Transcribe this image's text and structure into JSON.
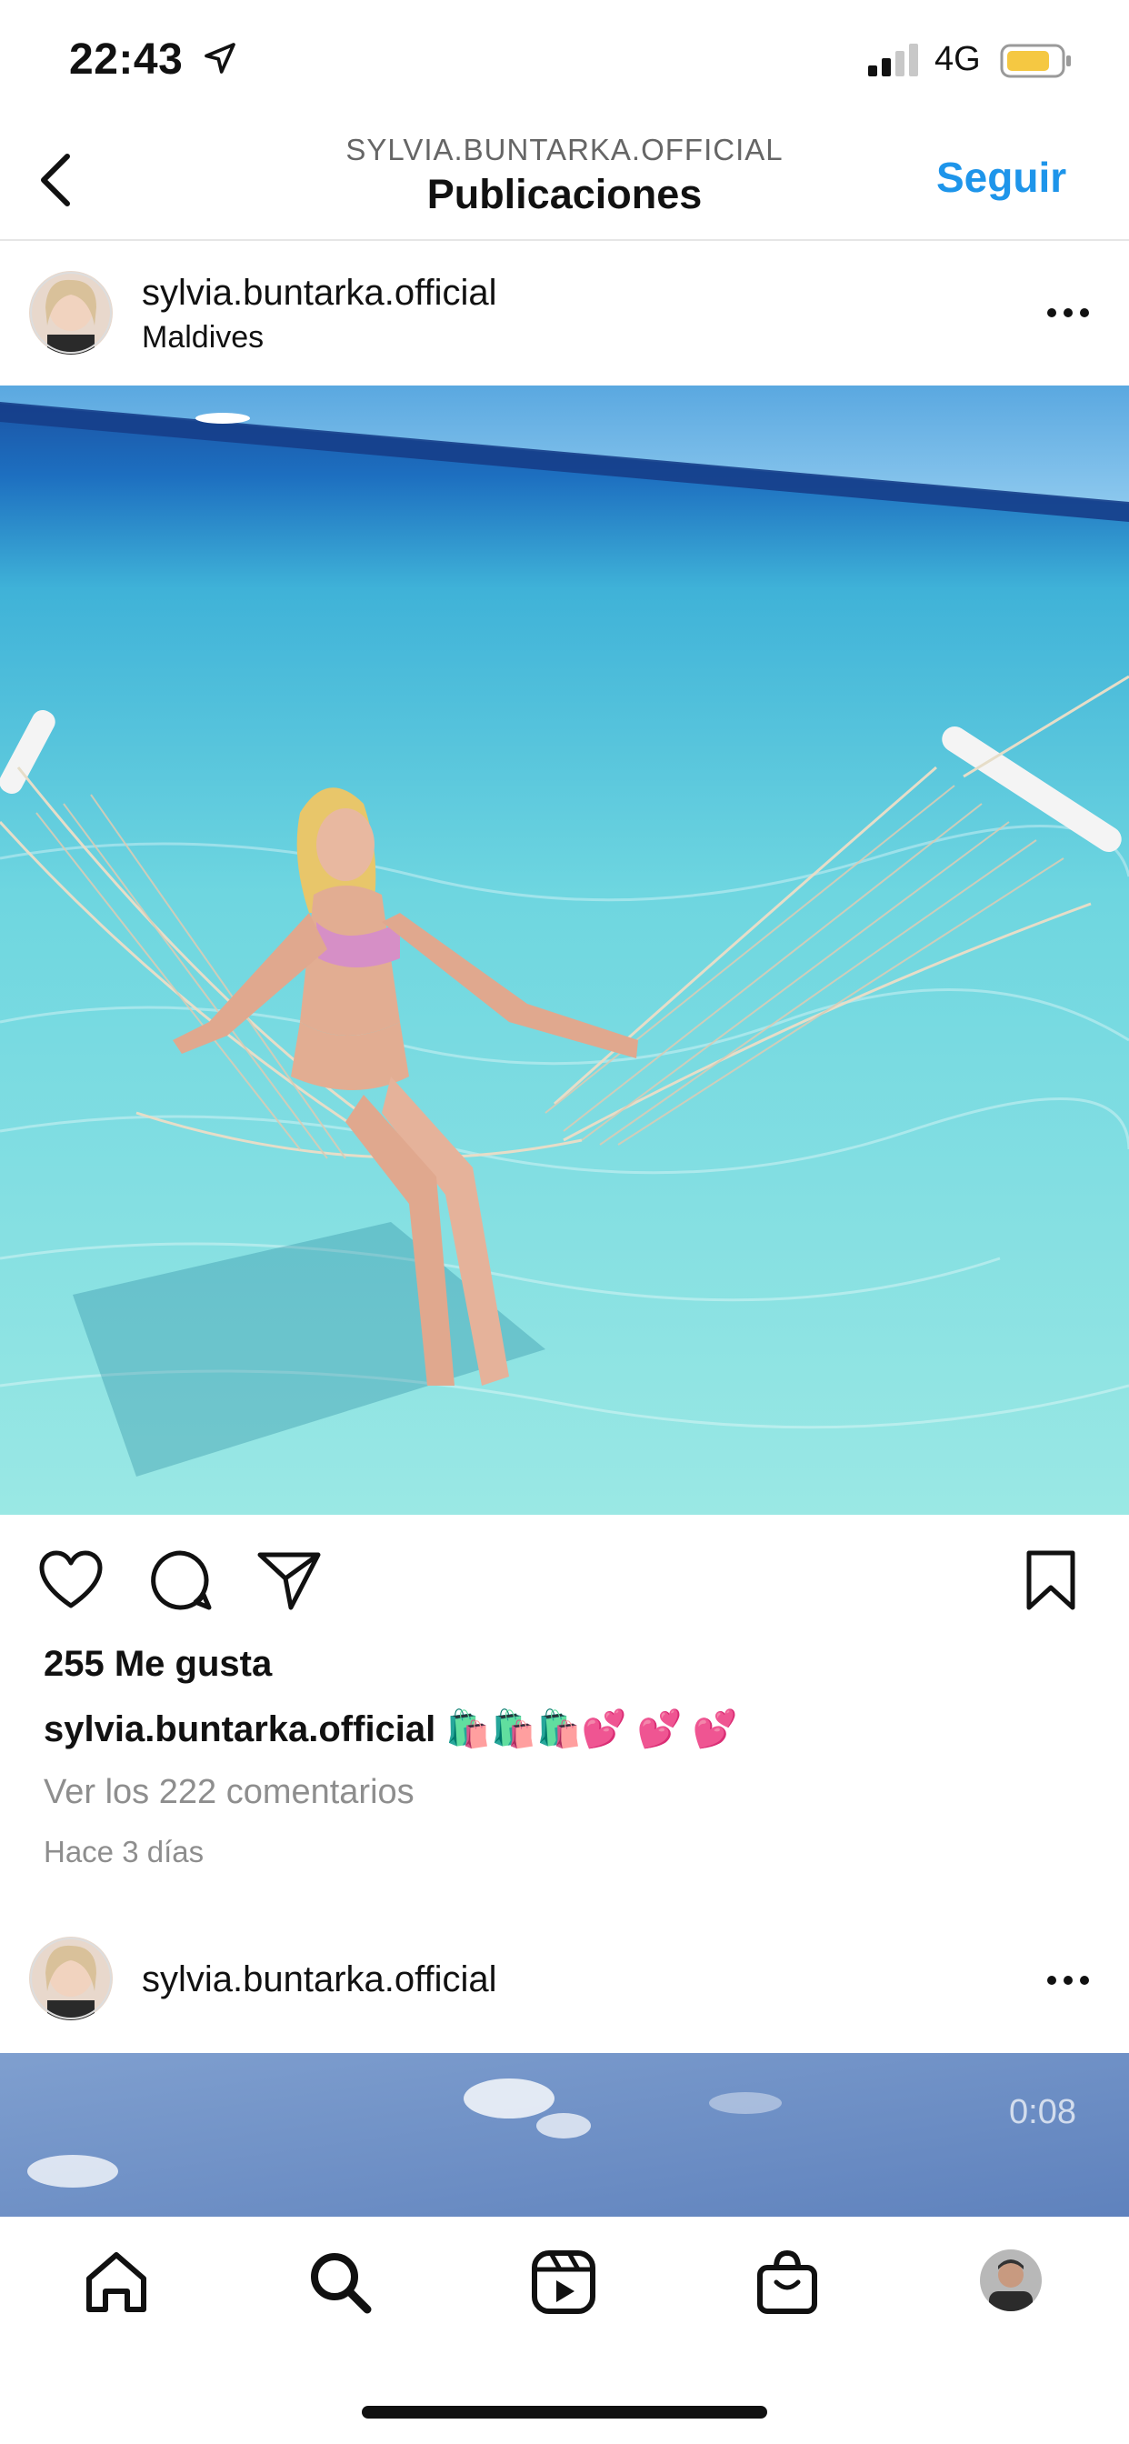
{
  "status_bar": {
    "time": "22:43",
    "network": "4G",
    "battery_color": "#f5c842"
  },
  "header": {
    "username": "SYLVIA.BUNTARKA.OFFICIAL",
    "title": "Publicaciones",
    "follow_label": "Seguir",
    "follow_color": "#1e95ea"
  },
  "post1": {
    "username": "sylvia.buntarka.official",
    "location": "Maldives",
    "likes": "255 Me gusta",
    "caption_user": "sylvia.buntarka.official",
    "caption_text": "🛍️🛍️🛍️💕 💕 💕",
    "view_comments": "Ver los 222 comentarios",
    "time_ago": "Hace 3 días"
  },
  "post2": {
    "username": "sylvia.buntarka.official",
    "video_time": "0:08"
  },
  "icons": {
    "back": "chevron-left-icon",
    "more": "more-horizontal-icon",
    "like": "heart-icon",
    "comment": "comment-bubble-icon",
    "share": "paper-plane-icon",
    "save": "bookmark-icon",
    "tabs": [
      "home-icon",
      "search-icon",
      "reels-icon",
      "shop-icon",
      "profile-avatar"
    ]
  }
}
